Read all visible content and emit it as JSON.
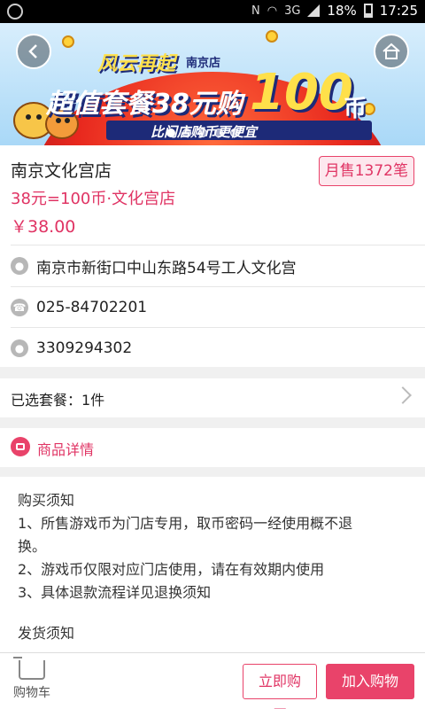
{
  "status_bar": {
    "network": "3G",
    "battery": "18%",
    "time": "17:25"
  },
  "banner": {
    "brand": "风云再起",
    "store": "南京店",
    "headline": "超值套餐38元购",
    "big_number": "100",
    "unit": "币",
    "subline": "比门店购币更便宜",
    "slide_count": 5,
    "active_slide": 1
  },
  "product": {
    "title": "南京文化宫店",
    "subtitle": "38元=100币·文化宫店",
    "price": "￥38.00",
    "sales_badge": "月售1372笔"
  },
  "info": {
    "address": "南京市新街口中山东路54号工人文化宫",
    "phone": "025-84702201",
    "qq": "3309294302"
  },
  "package": {
    "label": "已选套餐：1件"
  },
  "detail": {
    "label": "商品详情"
  },
  "notes": {
    "heading": "购买须知",
    "line1": "1、所售游戏币为门店专用，取币密码一经使用概不退",
    "line1b": "换。",
    "line2": "2、游戏币仅限对应门店使用，请在有效期内使用",
    "line3": "3、具体退款流程详见退换须知",
    "heading2": "发货须知"
  },
  "bottom": {
    "cart_label": "购物车",
    "buy_now": "立即购买",
    "add_cart": "加入购物车"
  },
  "colors": {
    "accent": "#e9436a",
    "accent_text": "#e03464"
  }
}
